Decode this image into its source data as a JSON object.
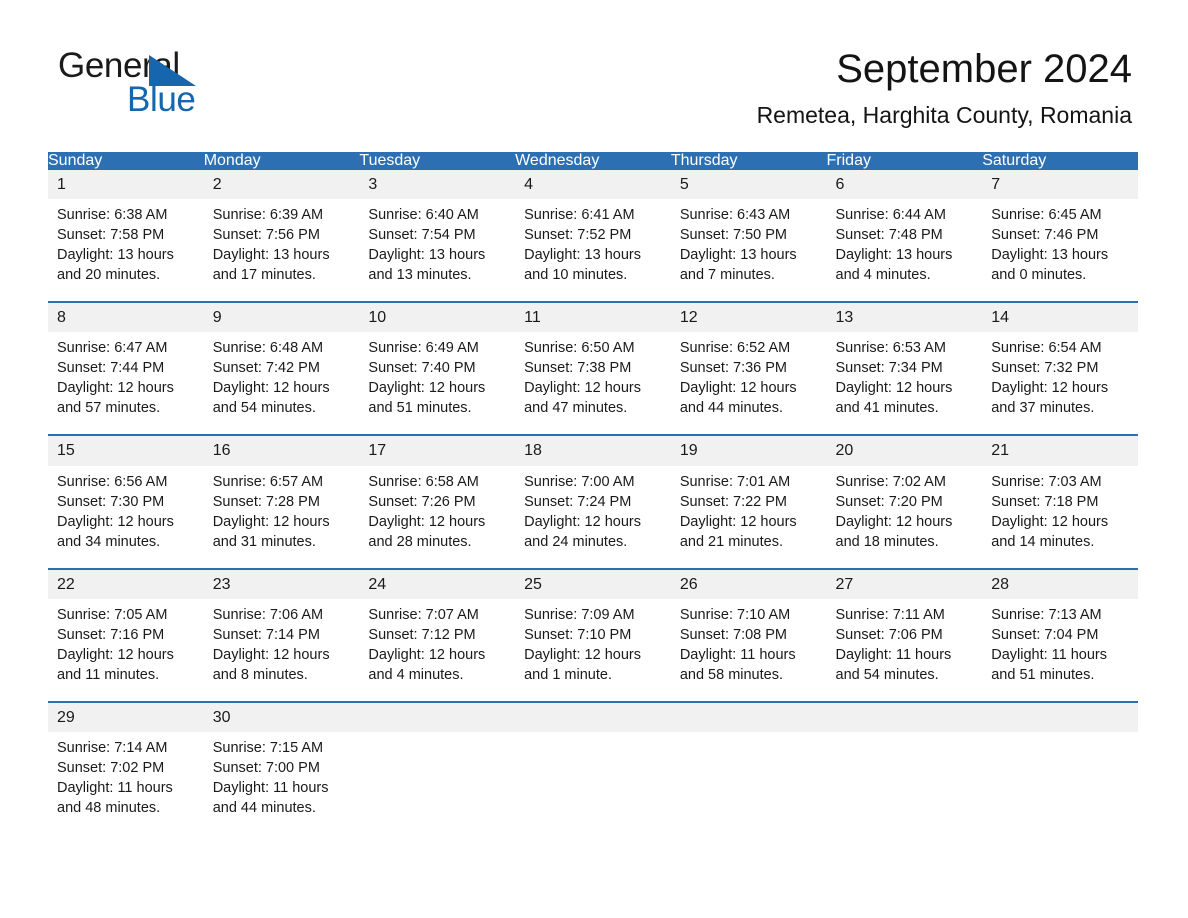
{
  "brand": {
    "word_general": "General",
    "word_blue": "Blue",
    "triangle_color": "#1566ad"
  },
  "header": {
    "month_title": "September 2024",
    "location": "Remetea, Harghita County, Romania"
  },
  "theme": {
    "header_blue": "#2c70b3",
    "daynum_gray": "#f1f1f1",
    "text": "#1a1a1a",
    "page_background": "#ffffff"
  },
  "weekday_headers": [
    "Sunday",
    "Monday",
    "Tuesday",
    "Wednesday",
    "Thursday",
    "Friday",
    "Saturday"
  ],
  "weeks": [
    {
      "days": [
        {
          "number": "1",
          "sunrise": "Sunrise: 6:38 AM",
          "sunset": "Sunset: 7:58 PM",
          "daylight_1": "Daylight: 13 hours",
          "daylight_2": "and 20 minutes."
        },
        {
          "number": "2",
          "sunrise": "Sunrise: 6:39 AM",
          "sunset": "Sunset: 7:56 PM",
          "daylight_1": "Daylight: 13 hours",
          "daylight_2": "and 17 minutes."
        },
        {
          "number": "3",
          "sunrise": "Sunrise: 6:40 AM",
          "sunset": "Sunset: 7:54 PM",
          "daylight_1": "Daylight: 13 hours",
          "daylight_2": "and 13 minutes."
        },
        {
          "number": "4",
          "sunrise": "Sunrise: 6:41 AM",
          "sunset": "Sunset: 7:52 PM",
          "daylight_1": "Daylight: 13 hours",
          "daylight_2": "and 10 minutes."
        },
        {
          "number": "5",
          "sunrise": "Sunrise: 6:43 AM",
          "sunset": "Sunset: 7:50 PM",
          "daylight_1": "Daylight: 13 hours",
          "daylight_2": "and 7 minutes."
        },
        {
          "number": "6",
          "sunrise": "Sunrise: 6:44 AM",
          "sunset": "Sunset: 7:48 PM",
          "daylight_1": "Daylight: 13 hours",
          "daylight_2": "and 4 minutes."
        },
        {
          "number": "7",
          "sunrise": "Sunrise: 6:45 AM",
          "sunset": "Sunset: 7:46 PM",
          "daylight_1": "Daylight: 13 hours",
          "daylight_2": "and 0 minutes."
        }
      ]
    },
    {
      "days": [
        {
          "number": "8",
          "sunrise": "Sunrise: 6:47 AM",
          "sunset": "Sunset: 7:44 PM",
          "daylight_1": "Daylight: 12 hours",
          "daylight_2": "and 57 minutes."
        },
        {
          "number": "9",
          "sunrise": "Sunrise: 6:48 AM",
          "sunset": "Sunset: 7:42 PM",
          "daylight_1": "Daylight: 12 hours",
          "daylight_2": "and 54 minutes."
        },
        {
          "number": "10",
          "sunrise": "Sunrise: 6:49 AM",
          "sunset": "Sunset: 7:40 PM",
          "daylight_1": "Daylight: 12 hours",
          "daylight_2": "and 51 minutes."
        },
        {
          "number": "11",
          "sunrise": "Sunrise: 6:50 AM",
          "sunset": "Sunset: 7:38 PM",
          "daylight_1": "Daylight: 12 hours",
          "daylight_2": "and 47 minutes."
        },
        {
          "number": "12",
          "sunrise": "Sunrise: 6:52 AM",
          "sunset": "Sunset: 7:36 PM",
          "daylight_1": "Daylight: 12 hours",
          "daylight_2": "and 44 minutes."
        },
        {
          "number": "13",
          "sunrise": "Sunrise: 6:53 AM",
          "sunset": "Sunset: 7:34 PM",
          "daylight_1": "Daylight: 12 hours",
          "daylight_2": "and 41 minutes."
        },
        {
          "number": "14",
          "sunrise": "Sunrise: 6:54 AM",
          "sunset": "Sunset: 7:32 PM",
          "daylight_1": "Daylight: 12 hours",
          "daylight_2": "and 37 minutes."
        }
      ]
    },
    {
      "days": [
        {
          "number": "15",
          "sunrise": "Sunrise: 6:56 AM",
          "sunset": "Sunset: 7:30 PM",
          "daylight_1": "Daylight: 12 hours",
          "daylight_2": "and 34 minutes."
        },
        {
          "number": "16",
          "sunrise": "Sunrise: 6:57 AM",
          "sunset": "Sunset: 7:28 PM",
          "daylight_1": "Daylight: 12 hours",
          "daylight_2": "and 31 minutes."
        },
        {
          "number": "17",
          "sunrise": "Sunrise: 6:58 AM",
          "sunset": "Sunset: 7:26 PM",
          "daylight_1": "Daylight: 12 hours",
          "daylight_2": "and 28 minutes."
        },
        {
          "number": "18",
          "sunrise": "Sunrise: 7:00 AM",
          "sunset": "Sunset: 7:24 PM",
          "daylight_1": "Daylight: 12 hours",
          "daylight_2": "and 24 minutes."
        },
        {
          "number": "19",
          "sunrise": "Sunrise: 7:01 AM",
          "sunset": "Sunset: 7:22 PM",
          "daylight_1": "Daylight: 12 hours",
          "daylight_2": "and 21 minutes."
        },
        {
          "number": "20",
          "sunrise": "Sunrise: 7:02 AM",
          "sunset": "Sunset: 7:20 PM",
          "daylight_1": "Daylight: 12 hours",
          "daylight_2": "and 18 minutes."
        },
        {
          "number": "21",
          "sunrise": "Sunrise: 7:03 AM",
          "sunset": "Sunset: 7:18 PM",
          "daylight_1": "Daylight: 12 hours",
          "daylight_2": "and 14 minutes."
        }
      ]
    },
    {
      "days": [
        {
          "number": "22",
          "sunrise": "Sunrise: 7:05 AM",
          "sunset": "Sunset: 7:16 PM",
          "daylight_1": "Daylight: 12 hours",
          "daylight_2": "and 11 minutes."
        },
        {
          "number": "23",
          "sunrise": "Sunrise: 7:06 AM",
          "sunset": "Sunset: 7:14 PM",
          "daylight_1": "Daylight: 12 hours",
          "daylight_2": "and 8 minutes."
        },
        {
          "number": "24",
          "sunrise": "Sunrise: 7:07 AM",
          "sunset": "Sunset: 7:12 PM",
          "daylight_1": "Daylight: 12 hours",
          "daylight_2": "and 4 minutes."
        },
        {
          "number": "25",
          "sunrise": "Sunrise: 7:09 AM",
          "sunset": "Sunset: 7:10 PM",
          "daylight_1": "Daylight: 12 hours",
          "daylight_2": "and 1 minute."
        },
        {
          "number": "26",
          "sunrise": "Sunrise: 7:10 AM",
          "sunset": "Sunset: 7:08 PM",
          "daylight_1": "Daylight: 11 hours",
          "daylight_2": "and 58 minutes."
        },
        {
          "number": "27",
          "sunrise": "Sunrise: 7:11 AM",
          "sunset": "Sunset: 7:06 PM",
          "daylight_1": "Daylight: 11 hours",
          "daylight_2": "and 54 minutes."
        },
        {
          "number": "28",
          "sunrise": "Sunrise: 7:13 AM",
          "sunset": "Sunset: 7:04 PM",
          "daylight_1": "Daylight: 11 hours",
          "daylight_2": "and 51 minutes."
        }
      ]
    },
    {
      "days": [
        {
          "number": "29",
          "sunrise": "Sunrise: 7:14 AM",
          "sunset": "Sunset: 7:02 PM",
          "daylight_1": "Daylight: 11 hours",
          "daylight_2": "and 48 minutes."
        },
        {
          "number": "30",
          "sunrise": "Sunrise: 7:15 AM",
          "sunset": "Sunset: 7:00 PM",
          "daylight_1": "Daylight: 11 hours",
          "daylight_2": "and 44 minutes."
        },
        {
          "number": "",
          "sunrise": "",
          "sunset": "",
          "daylight_1": "",
          "daylight_2": ""
        },
        {
          "number": "",
          "sunrise": "",
          "sunset": "",
          "daylight_1": "",
          "daylight_2": ""
        },
        {
          "number": "",
          "sunrise": "",
          "sunset": "",
          "daylight_1": "",
          "daylight_2": ""
        },
        {
          "number": "",
          "sunrise": "",
          "sunset": "",
          "daylight_1": "",
          "daylight_2": ""
        },
        {
          "number": "",
          "sunrise": "",
          "sunset": "",
          "daylight_1": "",
          "daylight_2": ""
        }
      ]
    }
  ]
}
